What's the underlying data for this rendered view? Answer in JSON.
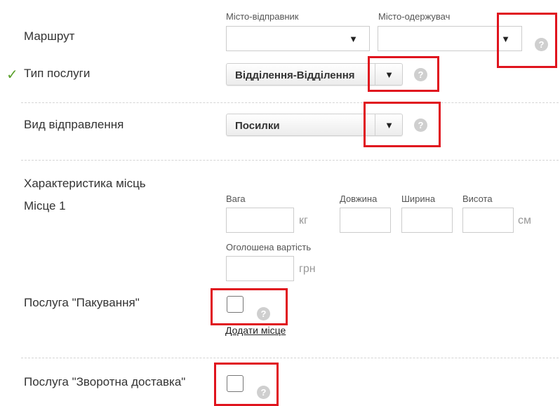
{
  "route": {
    "label": "Маршрут",
    "sender_city_label": "Місто-відправник",
    "sender_city_value": "",
    "recipient_city_label": "Місто-одержувач",
    "recipient_city_value": ""
  },
  "service_type": {
    "label": "Тип послуги",
    "value": "Відділення-Відділення",
    "status_icon": "checkmark-icon"
  },
  "shipment_type": {
    "label": "Вид відправлення",
    "value": "Посилки"
  },
  "places": {
    "label": "Характеристика місць",
    "place_label": "Місце 1",
    "weight_label": "Вага",
    "weight_unit": "кг",
    "length_label": "Довжина",
    "width_label": "Ширина",
    "height_label": "Висота",
    "size_unit": "см",
    "declared_value_label": "Оголошена вартість",
    "currency_unit": "грн"
  },
  "packing": {
    "label": "Послуга \"Пакування\"",
    "checked": false,
    "add_place_link": "Додати місце"
  },
  "return_delivery": {
    "label": "Послуга \"Зворотна доставка\"",
    "checked": false
  },
  "common": {
    "help_glyph": "?",
    "dropdown_glyph": "▼",
    "check_glyph": "✓"
  },
  "colors": {
    "highlight": "#e0141e",
    "checkmark": "#5aa02c",
    "help_icon": "#cfcfcf"
  }
}
